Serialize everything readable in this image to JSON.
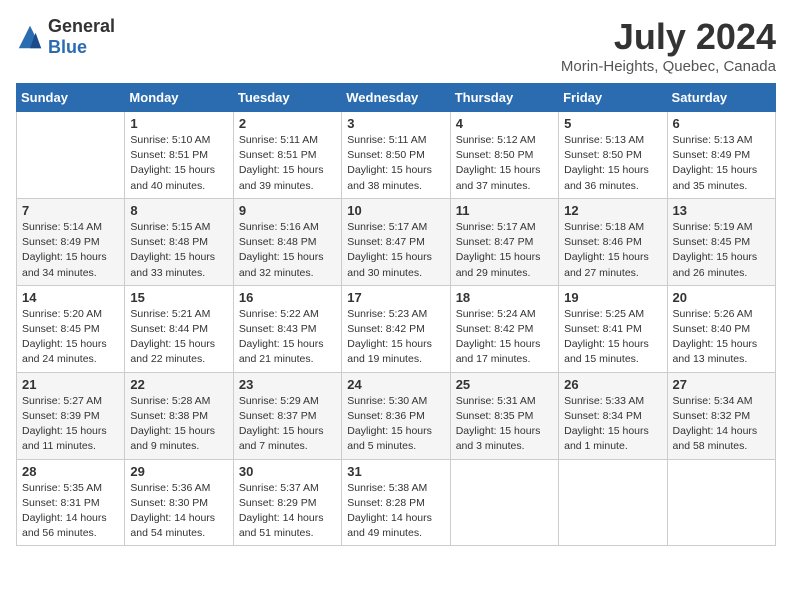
{
  "header": {
    "logo_general": "General",
    "logo_blue": "Blue",
    "month_year": "July 2024",
    "location": "Morin-Heights, Quebec, Canada"
  },
  "days_of_week": [
    "Sunday",
    "Monday",
    "Tuesday",
    "Wednesday",
    "Thursday",
    "Friday",
    "Saturday"
  ],
  "weeks": [
    [
      {
        "day": "",
        "info": ""
      },
      {
        "day": "1",
        "info": "Sunrise: 5:10 AM\nSunset: 8:51 PM\nDaylight: 15 hours\nand 40 minutes."
      },
      {
        "day": "2",
        "info": "Sunrise: 5:11 AM\nSunset: 8:51 PM\nDaylight: 15 hours\nand 39 minutes."
      },
      {
        "day": "3",
        "info": "Sunrise: 5:11 AM\nSunset: 8:50 PM\nDaylight: 15 hours\nand 38 minutes."
      },
      {
        "day": "4",
        "info": "Sunrise: 5:12 AM\nSunset: 8:50 PM\nDaylight: 15 hours\nand 37 minutes."
      },
      {
        "day": "5",
        "info": "Sunrise: 5:13 AM\nSunset: 8:50 PM\nDaylight: 15 hours\nand 36 minutes."
      },
      {
        "day": "6",
        "info": "Sunrise: 5:13 AM\nSunset: 8:49 PM\nDaylight: 15 hours\nand 35 minutes."
      }
    ],
    [
      {
        "day": "7",
        "info": "Sunrise: 5:14 AM\nSunset: 8:49 PM\nDaylight: 15 hours\nand 34 minutes."
      },
      {
        "day": "8",
        "info": "Sunrise: 5:15 AM\nSunset: 8:48 PM\nDaylight: 15 hours\nand 33 minutes."
      },
      {
        "day": "9",
        "info": "Sunrise: 5:16 AM\nSunset: 8:48 PM\nDaylight: 15 hours\nand 32 minutes."
      },
      {
        "day": "10",
        "info": "Sunrise: 5:17 AM\nSunset: 8:47 PM\nDaylight: 15 hours\nand 30 minutes."
      },
      {
        "day": "11",
        "info": "Sunrise: 5:17 AM\nSunset: 8:47 PM\nDaylight: 15 hours\nand 29 minutes."
      },
      {
        "day": "12",
        "info": "Sunrise: 5:18 AM\nSunset: 8:46 PM\nDaylight: 15 hours\nand 27 minutes."
      },
      {
        "day": "13",
        "info": "Sunrise: 5:19 AM\nSunset: 8:45 PM\nDaylight: 15 hours\nand 26 minutes."
      }
    ],
    [
      {
        "day": "14",
        "info": "Sunrise: 5:20 AM\nSunset: 8:45 PM\nDaylight: 15 hours\nand 24 minutes."
      },
      {
        "day": "15",
        "info": "Sunrise: 5:21 AM\nSunset: 8:44 PM\nDaylight: 15 hours\nand 22 minutes."
      },
      {
        "day": "16",
        "info": "Sunrise: 5:22 AM\nSunset: 8:43 PM\nDaylight: 15 hours\nand 21 minutes."
      },
      {
        "day": "17",
        "info": "Sunrise: 5:23 AM\nSunset: 8:42 PM\nDaylight: 15 hours\nand 19 minutes."
      },
      {
        "day": "18",
        "info": "Sunrise: 5:24 AM\nSunset: 8:42 PM\nDaylight: 15 hours\nand 17 minutes."
      },
      {
        "day": "19",
        "info": "Sunrise: 5:25 AM\nSunset: 8:41 PM\nDaylight: 15 hours\nand 15 minutes."
      },
      {
        "day": "20",
        "info": "Sunrise: 5:26 AM\nSunset: 8:40 PM\nDaylight: 15 hours\nand 13 minutes."
      }
    ],
    [
      {
        "day": "21",
        "info": "Sunrise: 5:27 AM\nSunset: 8:39 PM\nDaylight: 15 hours\nand 11 minutes."
      },
      {
        "day": "22",
        "info": "Sunrise: 5:28 AM\nSunset: 8:38 PM\nDaylight: 15 hours\nand 9 minutes."
      },
      {
        "day": "23",
        "info": "Sunrise: 5:29 AM\nSunset: 8:37 PM\nDaylight: 15 hours\nand 7 minutes."
      },
      {
        "day": "24",
        "info": "Sunrise: 5:30 AM\nSunset: 8:36 PM\nDaylight: 15 hours\nand 5 minutes."
      },
      {
        "day": "25",
        "info": "Sunrise: 5:31 AM\nSunset: 8:35 PM\nDaylight: 15 hours\nand 3 minutes."
      },
      {
        "day": "26",
        "info": "Sunrise: 5:33 AM\nSunset: 8:34 PM\nDaylight: 15 hours\nand 1 minute."
      },
      {
        "day": "27",
        "info": "Sunrise: 5:34 AM\nSunset: 8:32 PM\nDaylight: 14 hours\nand 58 minutes."
      }
    ],
    [
      {
        "day": "28",
        "info": "Sunrise: 5:35 AM\nSunset: 8:31 PM\nDaylight: 14 hours\nand 56 minutes."
      },
      {
        "day": "29",
        "info": "Sunrise: 5:36 AM\nSunset: 8:30 PM\nDaylight: 14 hours\nand 54 minutes."
      },
      {
        "day": "30",
        "info": "Sunrise: 5:37 AM\nSunset: 8:29 PM\nDaylight: 14 hours\nand 51 minutes."
      },
      {
        "day": "31",
        "info": "Sunrise: 5:38 AM\nSunset: 8:28 PM\nDaylight: 14 hours\nand 49 minutes."
      },
      {
        "day": "",
        "info": ""
      },
      {
        "day": "",
        "info": ""
      },
      {
        "day": "",
        "info": ""
      }
    ]
  ]
}
